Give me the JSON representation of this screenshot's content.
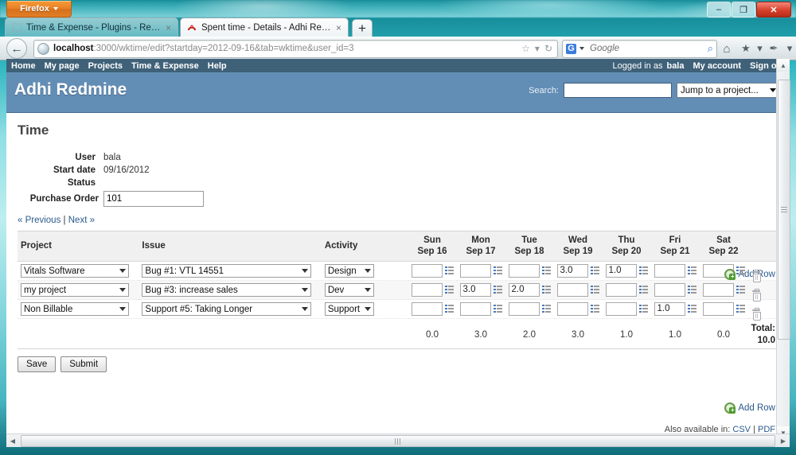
{
  "os": {
    "firefox_button": "Firefox",
    "minimize": "–",
    "maximize": "❐",
    "close": "✕"
  },
  "browser": {
    "tabs": [
      {
        "label": "Time & Expense - Plugins - Redmine",
        "active": false,
        "close": "×"
      },
      {
        "label": "Spent time - Details - Adhi Redmine",
        "active": true,
        "close": "×"
      }
    ],
    "new_tab_label": "+",
    "back_arrow": "←",
    "url_host": "localhost",
    "url_rest": ":3000/wktime/edit?startday=2012-09-16&tab=wktime&user_id=3",
    "star_icon": "☆",
    "dropmarker_icon": "▾",
    "reload_icon": "↻",
    "search_engine": "G",
    "search_placeholder": "Google",
    "search_magnifier": "⌕",
    "home_icon": "⌂",
    "bookmarks_icon": "★",
    "addons_icon": "✒",
    "overflow_icon": "▾"
  },
  "topmenu": {
    "left": [
      "Home",
      "My page",
      "Projects",
      "Time & Expense",
      "Help"
    ],
    "logged_in_prefix": "Logged in as",
    "logged_in_user": "bala",
    "my_account": "My account",
    "sign_out": "Sign out"
  },
  "header": {
    "app_title": "Adhi Redmine",
    "search_label": "Search:",
    "search_value": "",
    "jump_value": "Jump to a project..."
  },
  "page": {
    "title": "Time",
    "attributes": [
      {
        "label": "User",
        "value": "bala"
      },
      {
        "label": "Start date",
        "value": "09/16/2012"
      },
      {
        "label": "Status",
        "value": ""
      }
    ],
    "purchase_order_label": "Purchase Order",
    "purchase_order_value": "101",
    "previous_link": "« Previous",
    "separator": "|",
    "next_link": "Next »",
    "add_row_top": "Add Row",
    "add_row_bottom": "Add Row",
    "save_label": "Save",
    "submit_label": "Submit",
    "also_available_label": "Also available in:",
    "csv_link": "CSV",
    "pdf_link": "PDF",
    "format_separator": "|"
  },
  "grid": {
    "headers": {
      "project": "Project",
      "issue": "Issue",
      "activity": "Activity"
    },
    "days": [
      {
        "dow": "Sun",
        "date": "Sep 16"
      },
      {
        "dow": "Mon",
        "date": "Sep 17"
      },
      {
        "dow": "Tue",
        "date": "Sep 18"
      },
      {
        "dow": "Wed",
        "date": "Sep 19"
      },
      {
        "dow": "Thu",
        "date": "Sep 20"
      },
      {
        "dow": "Fri",
        "date": "Sep 21"
      },
      {
        "dow": "Sat",
        "date": "Sep 22"
      }
    ],
    "rows": [
      {
        "project": "Vitals Software",
        "issue": "Bug #1: VTL 14551",
        "activity": "Design",
        "hours": [
          "",
          "",
          "",
          "3.0",
          "1.0",
          "",
          ""
        ]
      },
      {
        "project": "my project",
        "issue": "Bug #3: increase sales",
        "activity": "Dev",
        "hours": [
          "",
          "3.0",
          "2.0",
          "",
          "",
          "",
          ""
        ]
      },
      {
        "project": "Non Billable",
        "issue": "Support #5: Taking Longer",
        "activity": "Support",
        "hours": [
          "",
          "",
          "",
          "",
          "",
          "1.0",
          ""
        ]
      }
    ],
    "day_totals": [
      "0.0",
      "3.0",
      "2.0",
      "3.0",
      "1.0",
      "1.0",
      "0.0"
    ],
    "total_label": "Total:",
    "total_value": "10.0"
  },
  "scroll": {
    "up": "▲",
    "down": "▼",
    "left": "◀",
    "right": "▶",
    "resize": "◢"
  }
}
